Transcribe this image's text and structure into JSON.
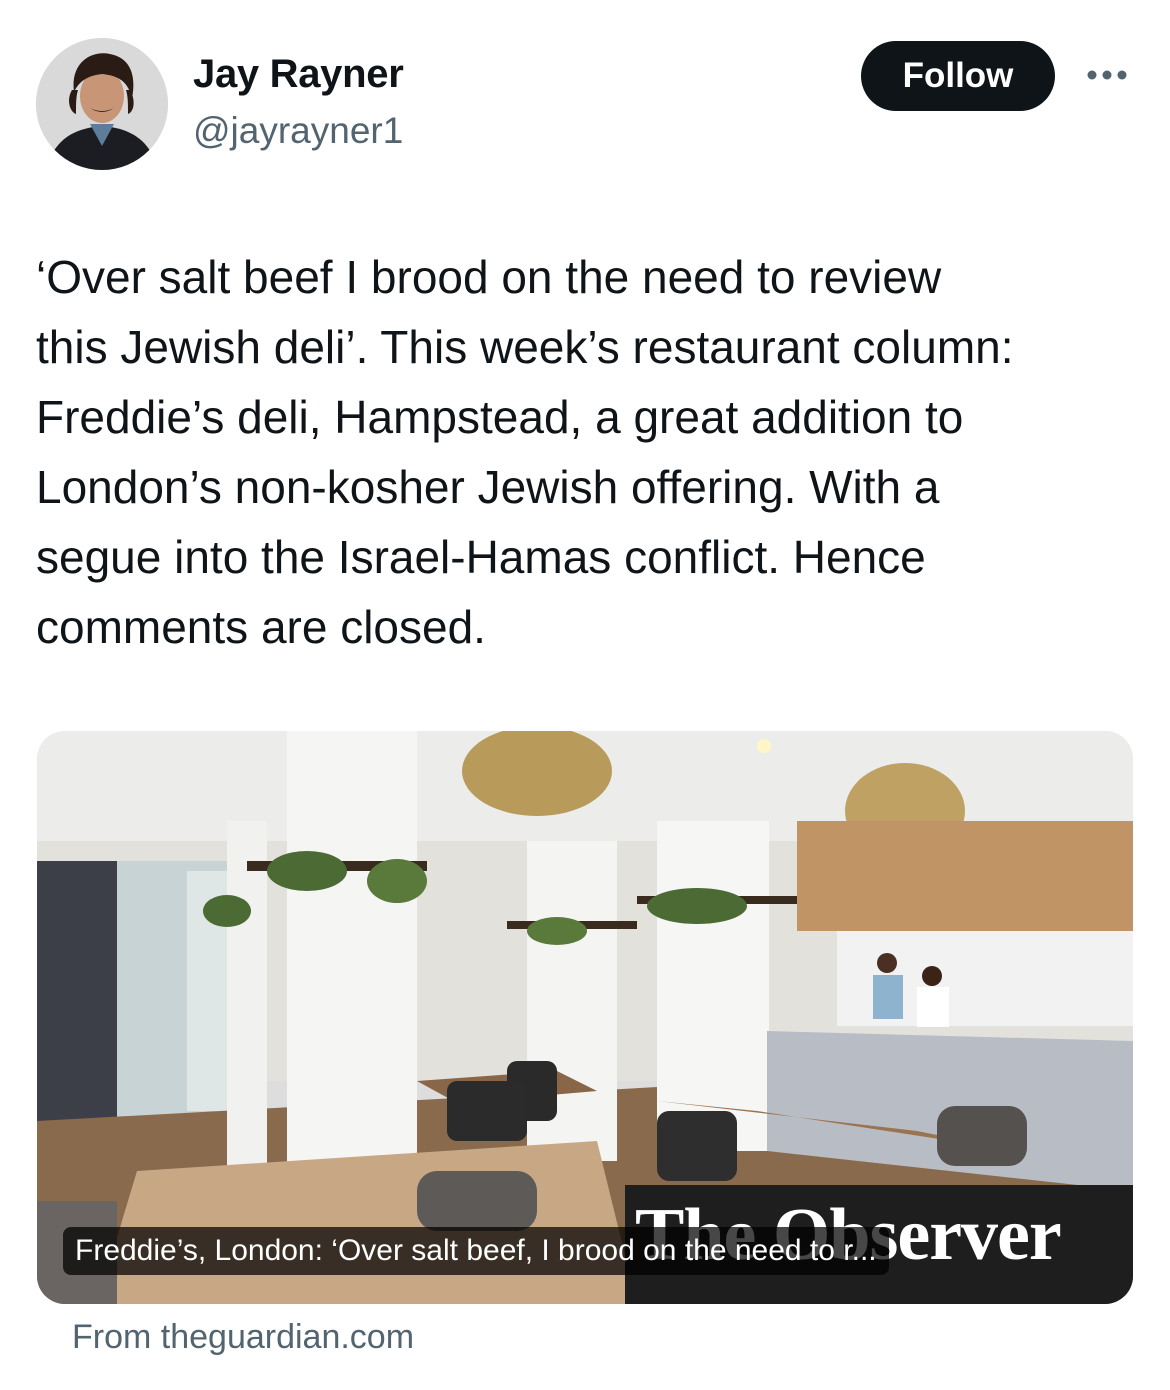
{
  "author": {
    "name": "Jay Rayner",
    "handle": "@jayrayner1",
    "avatar_icon": "person-portrait-icon"
  },
  "actions": {
    "follow_label": "Follow",
    "more_icon": "ellipsis-icon"
  },
  "tweet": {
    "text": "‘Over salt beef I brood on the need to review\nthis Jewish deli’. This week’s restaurant column:\nFreddie’s deli, Hampstead, a great addition to\nLondon’s non-kosher Jewish offering. With a\nsegue into the Israel-Hamas conflict. Hence\ncomments are closed."
  },
  "link_card": {
    "masthead": "The Observer",
    "caption": "Freddie’s, London: ‘Over salt beef, I brood on the need to r...",
    "source": "From theguardian.com"
  },
  "colors": {
    "text_primary": "#0f1419",
    "text_secondary": "#536471",
    "button_bg": "#0f1419",
    "button_text": "#ffffff"
  }
}
